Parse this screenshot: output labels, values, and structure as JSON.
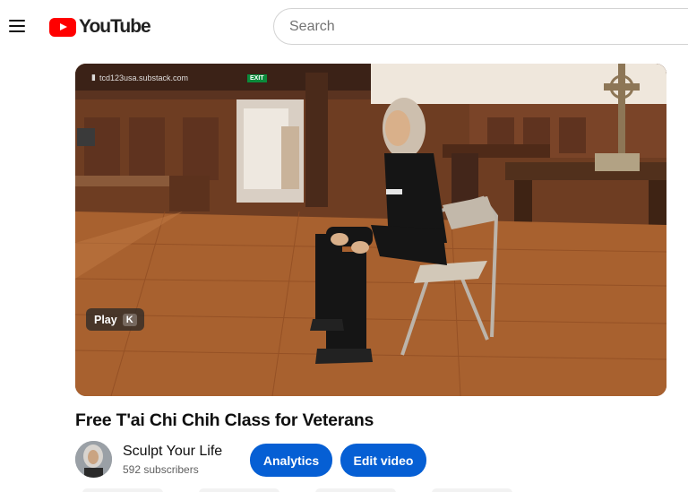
{
  "header": {
    "logo_text": "YouTube",
    "search_placeholder": "Search"
  },
  "video": {
    "watermark": "tcd123usa.substack.com",
    "exit_sign": "EXIT",
    "play_label": "Play",
    "play_shortcut": "K",
    "title": "Free T'ai Chi Chih Class for Veterans"
  },
  "channel": {
    "name": "Sculpt Your Life",
    "subscribers": "592 subscribers"
  },
  "actions": {
    "analytics_label": "Analytics",
    "edit_label": "Edit video"
  },
  "colors": {
    "brand_red": "#ff0000",
    "primary_button": "#065fd4"
  },
  "icons": [
    "menu-icon",
    "youtube-logo-icon",
    "bookmark-icon"
  ]
}
